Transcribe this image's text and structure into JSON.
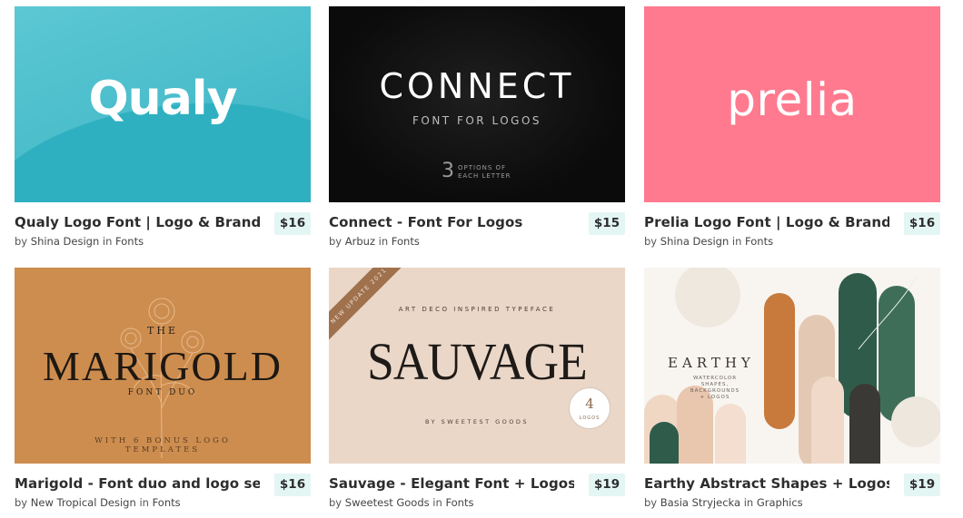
{
  "cards": [
    {
      "title": "Qualy Logo Font | Logo & Branding",
      "price": "$16",
      "by": "by",
      "author": "Shina Design",
      "in": "in",
      "category": "Fonts",
      "thumb": {
        "logo": "Qualy"
      }
    },
    {
      "title": "Connect - Font For Logos",
      "price": "$15",
      "by": "by",
      "author": "Arbuz",
      "in": "in",
      "category": "Fonts",
      "thumb": {
        "logo": "CONNECT",
        "subtitle": "FONT FOR LOGOS",
        "options_num": "3",
        "options_l1": "OPTIONS OF",
        "options_l2": "EACH LETTER"
      }
    },
    {
      "title": "Prelia Logo Font | Logo & Branding",
      "price": "$16",
      "by": "by",
      "author": "Shina Design",
      "in": "in",
      "category": "Fonts",
      "thumb": {
        "logo": "prelia"
      }
    },
    {
      "title": "Marigold - Font duo and logo set",
      "price": "$16",
      "by": "by",
      "author": "New Tropical Design",
      "in": "in",
      "category": "Fonts",
      "thumb": {
        "the": "THE",
        "logo": "MARIGOLD",
        "duo": "FONT DUO",
        "bonus_l1": "WITH 6 BONUS LOGO",
        "bonus_l2": "TEMPLATES"
      }
    },
    {
      "title": "Sauvage - Elegant Font + Logos",
      "price": "$19",
      "by": "by",
      "author": "Sweetest Goods",
      "in": "in",
      "category": "Fonts",
      "thumb": {
        "ribbon": "NEW UPDATE 2021",
        "top": "ART DECO INSPIRED TYPEFACE",
        "logo": "SAUVAGE",
        "by": "BY SWEETEST GOODS",
        "badge_num": "4",
        "badge_label": "LOGOS"
      }
    },
    {
      "title": "Earthy Abstract Shapes + Logos",
      "price": "$19",
      "by": "by",
      "author": "Basia Stryjecka",
      "in": "in",
      "category": "Graphics",
      "thumb": {
        "logo": "EARTHY",
        "sub_l1": "WATERCOLOR SHAPES,",
        "sub_l2": "BACKGROUNDS",
        "sub_l3": "+ LOGOS"
      }
    }
  ],
  "colors": {
    "price_bg": "#e4f6f4",
    "qualy": "#4bbdcc",
    "connect": "#111111",
    "prelia": "#ff7a8e",
    "marigold": "#cd8d4f",
    "sauvage": "#ead7c8",
    "earthy": "#f8f5f1"
  }
}
